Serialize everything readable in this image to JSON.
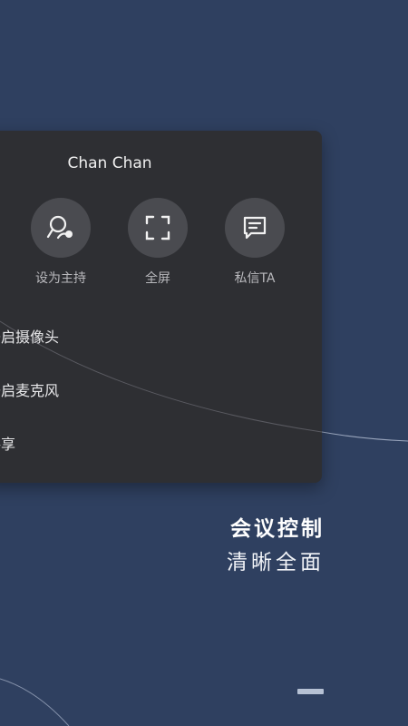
{
  "participant": {
    "name": "Chan Chan"
  },
  "actions": [
    {
      "label": "设为主持",
      "icon": "host-icon"
    },
    {
      "label": "全屏",
      "icon": "fullscreen-icon"
    },
    {
      "label": "私信TA",
      "icon": "message-icon"
    }
  ],
  "menu": [
    {
      "label": "开启摄像头"
    },
    {
      "label": "开启麦克风"
    },
    {
      "label": "共享"
    }
  ],
  "caption": {
    "title": "会议控制",
    "subtitle": "清晰全面"
  },
  "colors": {
    "background": "#2f4060",
    "panel": "#2e2f33",
    "action_circle": "#4a4b50",
    "indicator": "#b6c1d4"
  }
}
